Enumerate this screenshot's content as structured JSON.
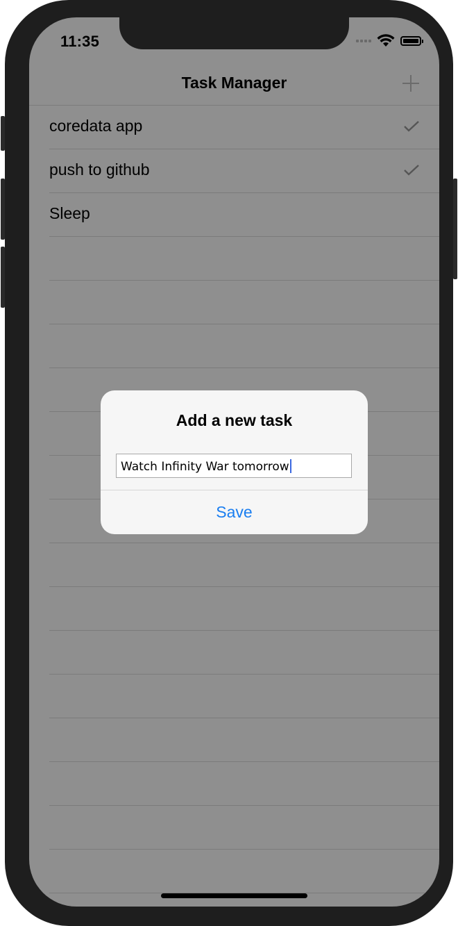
{
  "status_bar": {
    "time": "11:35",
    "signal_icon": "cellular-dots-icon",
    "wifi_icon": "wifi-icon",
    "battery_icon": "battery-full-icon"
  },
  "navbar": {
    "title": "Task Manager",
    "add_icon": "plus-icon"
  },
  "tasks": [
    {
      "label": "coredata app",
      "completed": true
    },
    {
      "label": "push to github",
      "completed": true
    },
    {
      "label": "Sleep",
      "completed": false
    }
  ],
  "alert": {
    "title": "Add a new task",
    "input_value": "Watch Infinity War tomorrow",
    "save_label": "Save"
  },
  "colors": {
    "dimmed_background": "#8f8f8f",
    "alert_background": "#f6f6f6",
    "accent": "#1a7ef0",
    "caret": "#3a68e0"
  }
}
